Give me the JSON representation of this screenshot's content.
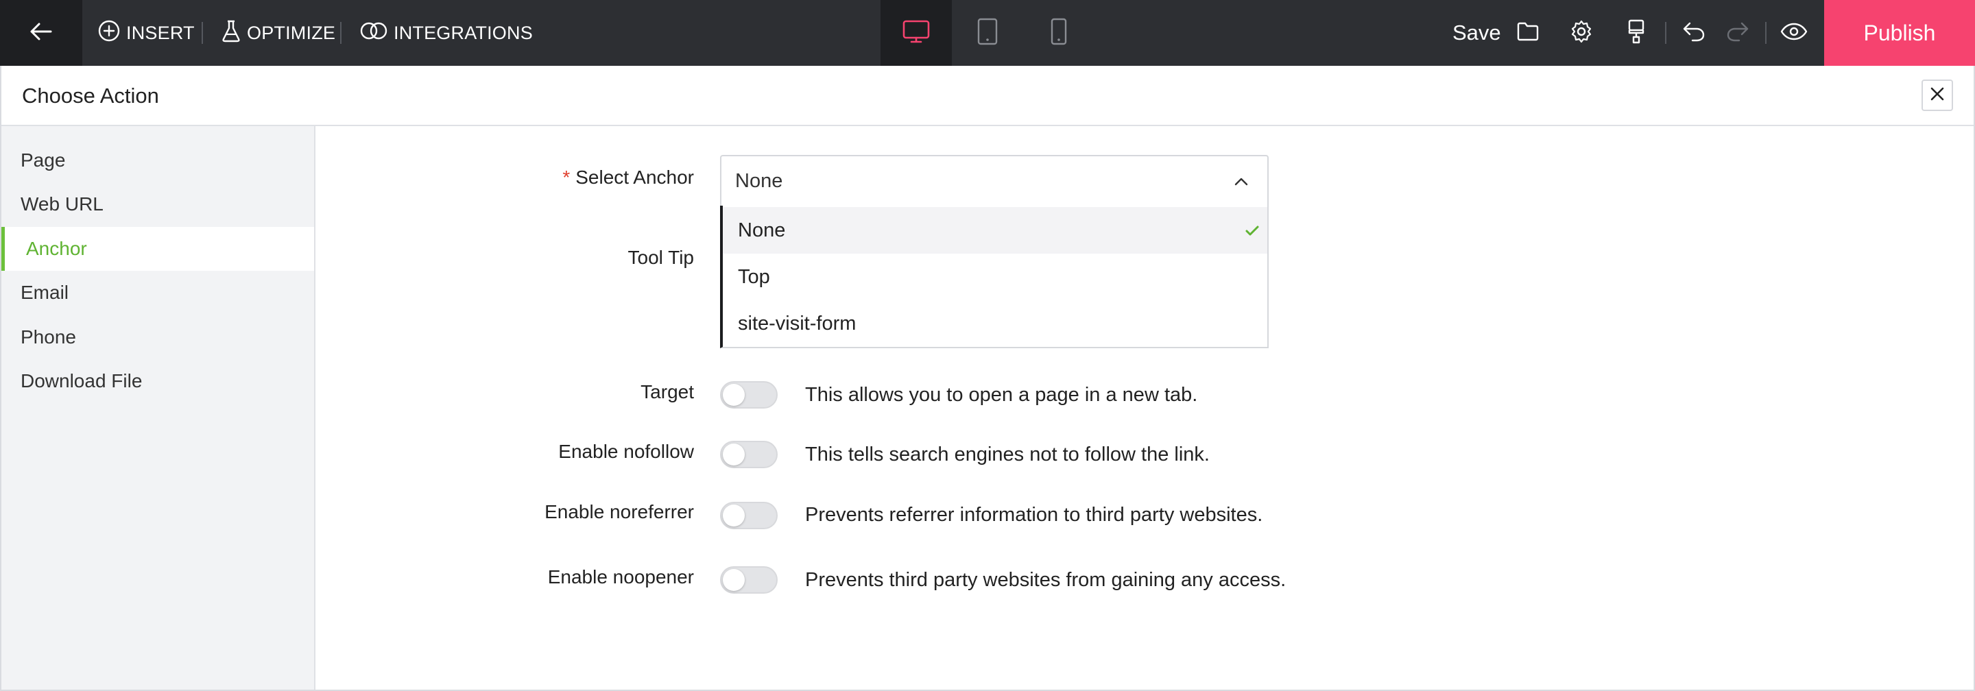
{
  "toolbar": {
    "insert_label": "INSERT",
    "optimize_label": "OPTIMIZE",
    "integrations_label": "INTEGRATIONS",
    "devices": [
      "desktop-icon",
      "tablet-icon",
      "mobile-icon"
    ],
    "active_device": "desktop",
    "save_label": "Save",
    "publish_label": "Publish",
    "accent_color": "#f6436f"
  },
  "panel": {
    "title": "Choose Action"
  },
  "sidebar": {
    "items": [
      {
        "label": "Page"
      },
      {
        "label": "Web URL"
      },
      {
        "label": "Anchor"
      },
      {
        "label": "Email"
      },
      {
        "label": "Phone"
      },
      {
        "label": "Download File"
      }
    ],
    "active_index": 2,
    "active_color": "#5fb332"
  },
  "form": {
    "anchor": {
      "required_mark": "*",
      "label": "Select Anchor",
      "value": "None",
      "options": [
        "None",
        "Top",
        "site-visit-form"
      ]
    },
    "tooltip_label": "Tool Tip",
    "toggles": [
      {
        "label": "Target",
        "description": "This allows you to open a page in a new tab.",
        "on": false
      },
      {
        "label": "Enable nofollow",
        "description": "This tells search engines not to follow the link.",
        "on": false
      },
      {
        "label": "Enable noreferrer",
        "description": "Prevents referrer information to third party websites.",
        "on": false
      },
      {
        "label": "Enable noopener",
        "description": "Prevents third party websites from gaining any access.",
        "on": false
      }
    ]
  }
}
